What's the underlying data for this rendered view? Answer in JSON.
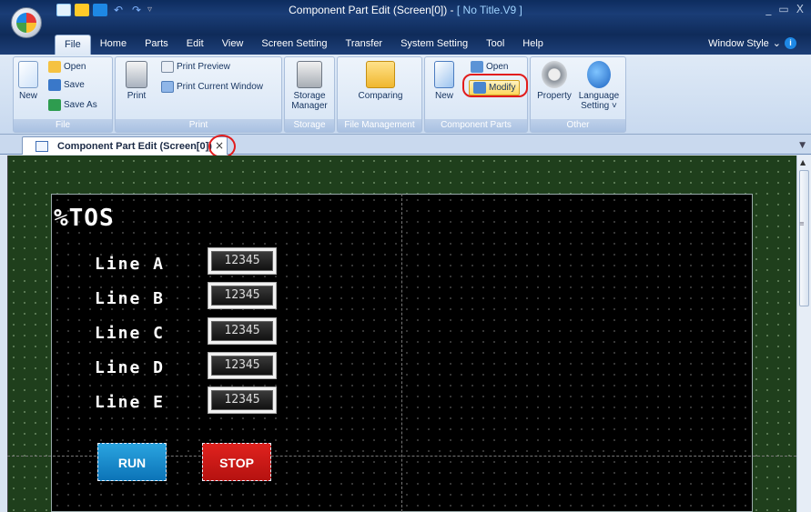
{
  "window": {
    "title_prefix": "Component Part Edit (Screen[0]) - ",
    "title_name": "[ No Title.V9 ]",
    "min_glyph": "_",
    "restore_glyph": "▭",
    "close_glyph": "X"
  },
  "quick_access": {
    "undo_glyph": "↶",
    "redo_glyph": "↷",
    "dropdown_glyph": "▿"
  },
  "ribbon_tabs": [
    "File",
    "Home",
    "Parts",
    "Edit",
    "View",
    "Screen Setting",
    "Transfer",
    "System Setting",
    "Tool",
    "Help"
  ],
  "active_tab": "File",
  "window_style": {
    "label": "Window Style",
    "chevron": "⌄",
    "info": "i"
  },
  "ribbon": {
    "file_group": {
      "label": "File",
      "new": "New",
      "open": "Open",
      "save": "Save",
      "save_as": "Save As"
    },
    "print_group": {
      "label": "Print",
      "print": "Print",
      "print_preview": "Print Preview",
      "print_current_window": "Print Current Window"
    },
    "storage_group": {
      "label": "Storage",
      "storage_manager_1": "Storage",
      "storage_manager_2": "Manager"
    },
    "file_mgmt_group": {
      "label": "File Management",
      "comparing": "Comparing"
    },
    "component_group": {
      "label": "Component Parts",
      "new": "New",
      "open": "Open",
      "modify": "Modify"
    },
    "other_group": {
      "label": "Other",
      "property": "Property",
      "language_setting_1": "Language",
      "language_setting_2": "Setting ˅"
    }
  },
  "doc_tab": {
    "label": "Component Part Edit (Screen[0])",
    "close": "×",
    "list_arrow": "▼"
  },
  "screen": {
    "title": "%TOS",
    "lines": [
      {
        "label": "Line A",
        "value": "12345"
      },
      {
        "label": "Line B",
        "value": "12345"
      },
      {
        "label": "Line C",
        "value": "12345"
      },
      {
        "label": "Line D",
        "value": "12345"
      },
      {
        "label": "Line E",
        "value": "12345"
      }
    ],
    "run_label": "RUN",
    "stop_label": "STOP"
  },
  "scrollbar": {
    "up_arrow": "▲",
    "grip": "≡"
  },
  "colors": {
    "highlight_ring": "#e21c1c",
    "run_button": "#1a8fd0",
    "stop_button": "#d51a17",
    "editor_grid": "#1f3f1c"
  }
}
